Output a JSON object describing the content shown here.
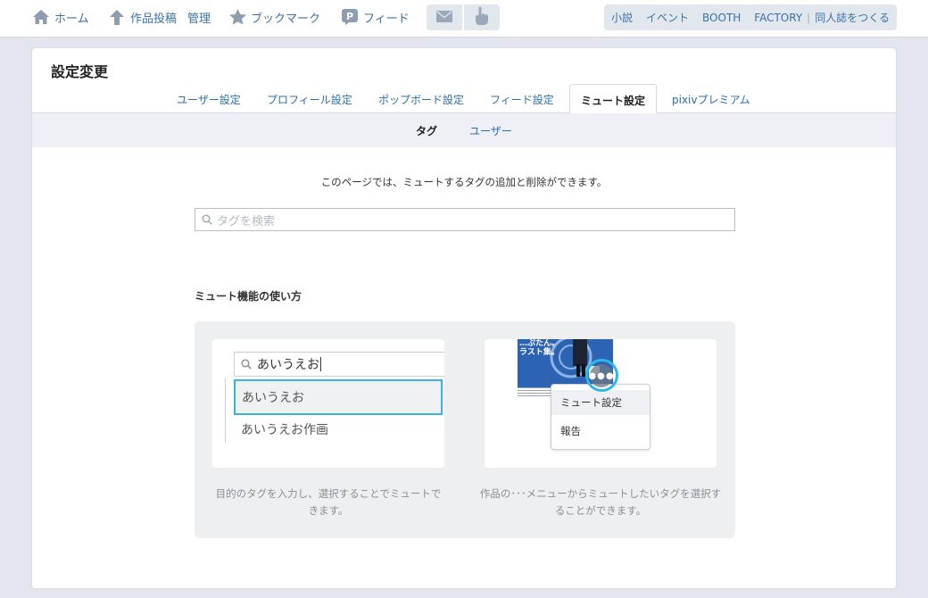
{
  "topnav": {
    "home": "ホーム",
    "upload": "作品投稿",
    "manage": "管理",
    "bookmark": "ブックマーク",
    "feed": "フィード",
    "icons": {
      "home": "home-icon",
      "upload": "upload-arrow-icon",
      "bookmark": "star-icon",
      "feed": "feed-icon",
      "mail": "mail-icon",
      "notify": "notification-hand-icon"
    },
    "right_links": [
      "小説",
      "イベント",
      "BOOTH",
      "FACTORY",
      "同人誌をつくる"
    ]
  },
  "page": {
    "title": "設定変更"
  },
  "tabs": [
    {
      "label": "ユーザー設定",
      "active": false
    },
    {
      "label": "プロフィール設定",
      "active": false
    },
    {
      "label": "ポップボード設定",
      "active": false
    },
    {
      "label": "フィード設定",
      "active": false
    },
    {
      "label": "ミュート設定",
      "active": true
    },
    {
      "label": "pixivプレミアム",
      "active": false
    }
  ],
  "subtabs": [
    {
      "label": "タグ",
      "active": true
    },
    {
      "label": "ユーザー",
      "active": false
    }
  ],
  "main": {
    "description": "このページでは、ミュートするタグの追加と削除ができます。",
    "search_placeholder": "タグを検索"
  },
  "howto": {
    "title": "ミュート機能の使い方",
    "left": {
      "input_text": "あいうえお",
      "option_1": "あいうえお",
      "option_2": "あいうえお作画",
      "caption": "目的のタグを入力し、選択することでミュートできます。"
    },
    "right": {
      "art_text": "…ぷたん。\nラスト集。",
      "menu_item_1": "ミュート設定",
      "menu_item_2": "報告",
      "caption": "作品の･･･メニューからミュートしたいタグを選択することができます。"
    }
  },
  "colors": {
    "link": "#3a72a9",
    "highlight": "#2cb8e6",
    "background": "#e3e6ee"
  }
}
